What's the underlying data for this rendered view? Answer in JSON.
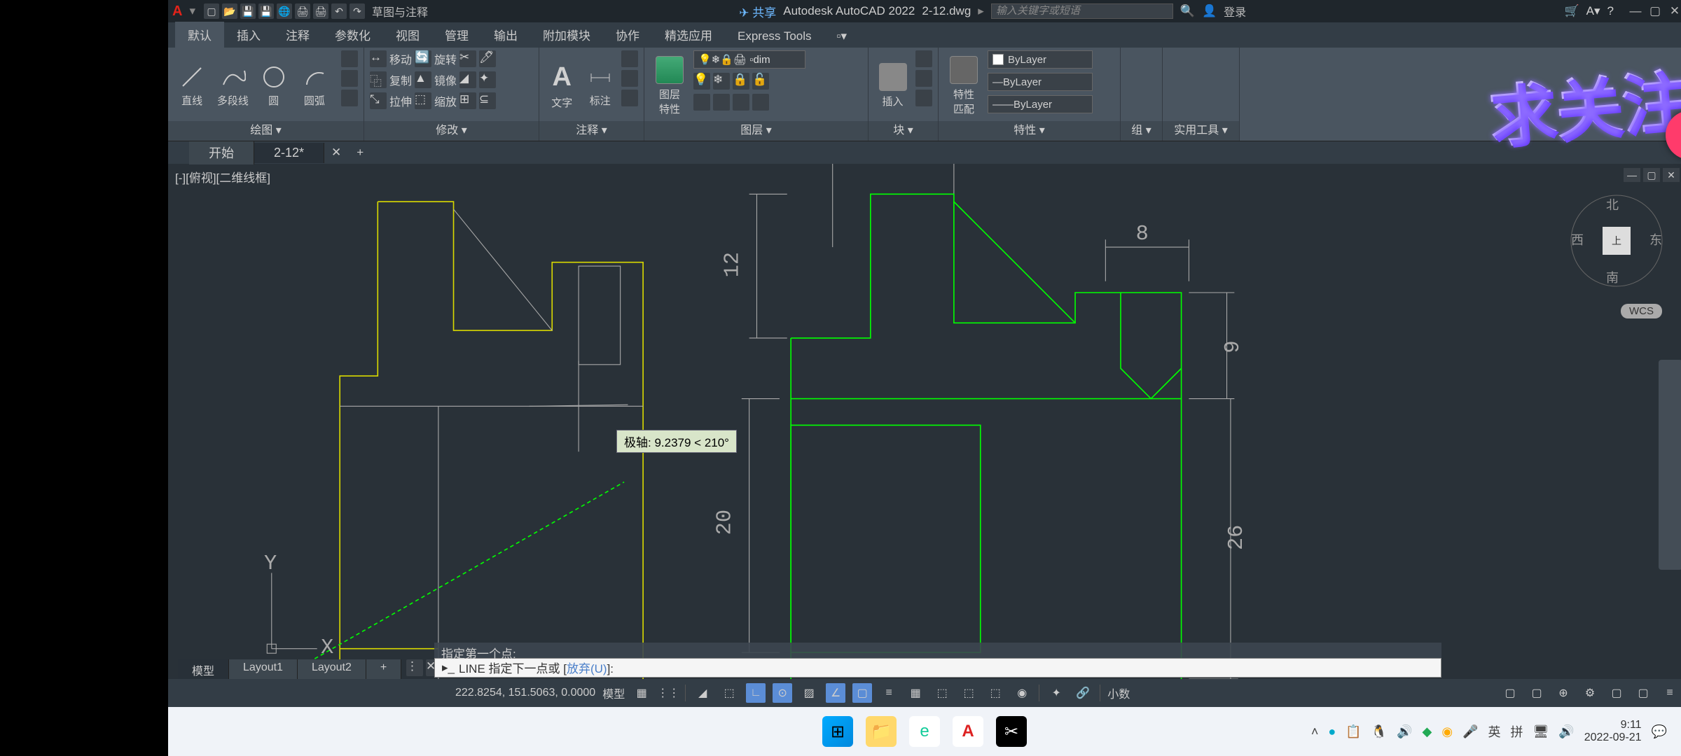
{
  "title_bar": {
    "app_name": "Autodesk AutoCAD 2022",
    "file_name": "2-12.dwg",
    "share": "共享",
    "search_placeholder": "输入关键字或短语",
    "login": "登录",
    "workspace": "草图与注释"
  },
  "menu_tabs": [
    "默认",
    "插入",
    "注释",
    "参数化",
    "视图",
    "管理",
    "输出",
    "附加模块",
    "协作",
    "精选应用",
    "Express Tools"
  ],
  "ribbon": {
    "draw": {
      "title": "绘图 ▾",
      "line": "直线",
      "polyline": "多段线",
      "circle": "圆",
      "arc": "圆弧"
    },
    "modify": {
      "title": "修改 ▾",
      "move": "移动",
      "rotate": "旋转",
      "copy": "复制",
      "mirror": "镜像",
      "stretch": "拉伸",
      "scale": "缩放"
    },
    "annotate": {
      "title": "注释 ▾",
      "text": "文字",
      "dim": "标注"
    },
    "layer": {
      "title": "图层 ▾",
      "btn": "图层\n特性",
      "current": "dim"
    },
    "insert": {
      "title": "块 ▾",
      "btn": "插入"
    },
    "properties": {
      "title": "特性 ▾",
      "btn": "特性\n匹配",
      "bylayer": "ByLayer"
    },
    "group": {
      "title": "组 ▾"
    },
    "utilities": {
      "title": "实用工具 ▾"
    }
  },
  "overlay_text": "求关注",
  "file_tabs": {
    "start": "开始",
    "current": "2-12*"
  },
  "viewport": {
    "label": "[-][俯视][二维线框]"
  },
  "tooltip": "极轴: 9.2379 < 210°",
  "viewcube": {
    "n": "北",
    "s": "南",
    "w": "西",
    "e": "东",
    "top": "上",
    "wcs": "WCS"
  },
  "command": {
    "history": "指定第一个点:",
    "prompt": "LINE 指定下一点或 [",
    "option": "放弃(U)",
    "suffix": "]:"
  },
  "layout_tabs": [
    "模型",
    "Layout1",
    "Layout2"
  ],
  "status_bar": {
    "coords": "222.8254, 151.5063, 0.0000",
    "model": "模型",
    "precision": "小数"
  },
  "chart_data": {
    "type": "diagram",
    "dimensions": {
      "d1": "8",
      "d2": "12",
      "d3": "9",
      "d4": "20",
      "d5": "26"
    },
    "ucs": {
      "x": "X",
      "y": "Y"
    }
  },
  "taskbar": {
    "ime_lang": "英",
    "ime_mode": "拼",
    "time": "9:11",
    "date": "2022-09-21"
  }
}
